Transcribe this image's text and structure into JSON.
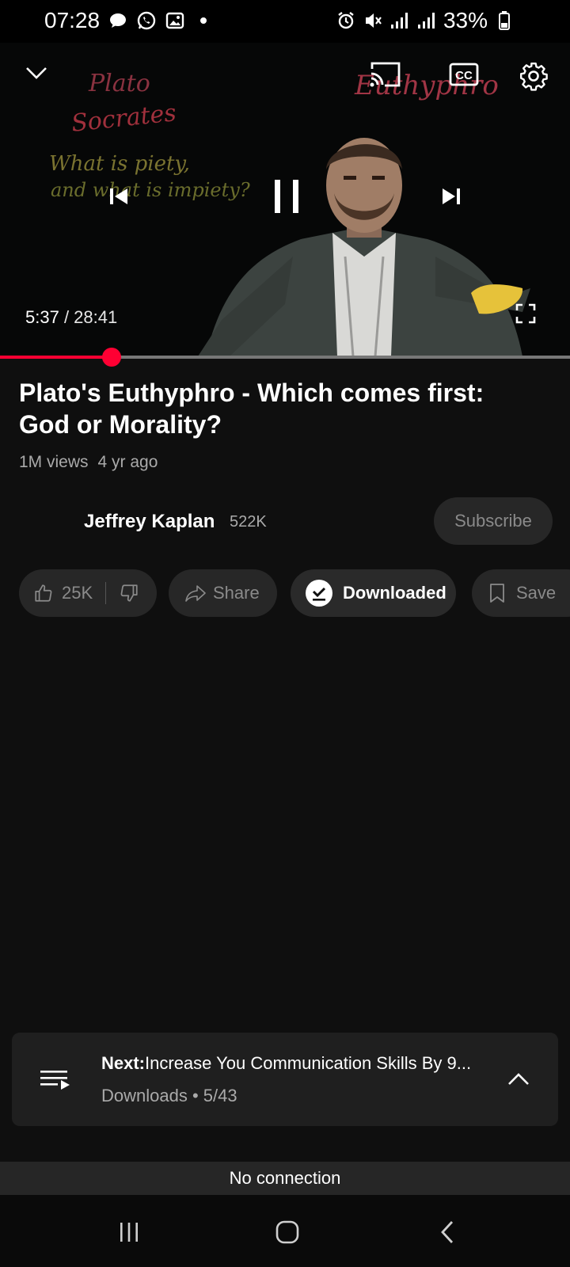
{
  "status_bar": {
    "time": "07:28",
    "battery": "33%",
    "left_icons": [
      "chat-bubble-icon",
      "whatsapp-icon",
      "gallery-icon",
      "dot-icon"
    ],
    "right_icons": [
      "alarm-icon",
      "mute-icon",
      "signal-icon",
      "signal-icon",
      "battery-icon"
    ]
  },
  "player": {
    "current_time": "5:37",
    "separator": " / ",
    "duration": "28:41",
    "progress_fraction": 0.196,
    "board_text": {
      "line1": "Plato",
      "line2": "Socrates",
      "line3": "What is piety,",
      "line4": "and what is impiety?",
      "top_right": "Euthyphro"
    },
    "icons": [
      "chevron-down-icon",
      "cast-icon",
      "cc-icon",
      "gear-icon",
      "previous-icon",
      "pause-icon",
      "next-icon",
      "fullscreen-icon"
    ]
  },
  "video": {
    "title": "Plato's Euthyphro - Which comes first: God or Morality?",
    "views": "1M views",
    "age": "4 yr ago"
  },
  "channel": {
    "name": "Jeffrey Kaplan",
    "subscribers": "522K",
    "subscribe_label": "Subscribe"
  },
  "actions": {
    "likes": "25K",
    "share_label": "Share",
    "download_label": "Downloaded",
    "save_label": "Save"
  },
  "next_up": {
    "prefix": "Next:",
    "title": "Increase You Communication Skills By 9...",
    "playlist": "Downloads",
    "dot": " • ",
    "position": "5/43"
  },
  "banner": {
    "text": "No connection"
  },
  "colors": {
    "accent": "#ff0033",
    "background": "#0f0f0f",
    "pill": "#272727",
    "secondary_text": "#aaaaaa"
  }
}
